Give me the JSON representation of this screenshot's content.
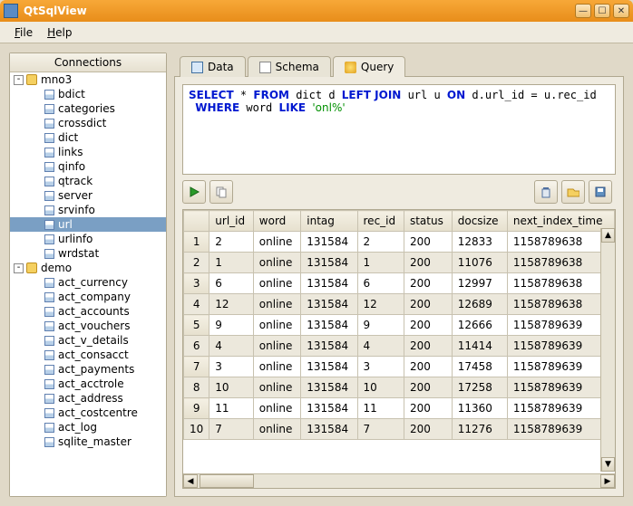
{
  "window": {
    "title": "QtSqlView"
  },
  "menu": {
    "file": "File",
    "help": "Help"
  },
  "sidebar": {
    "header": "Connections",
    "dbs": [
      {
        "name": "mno3",
        "tables": [
          "bdict",
          "categories",
          "crossdict",
          "dict",
          "links",
          "qinfo",
          "qtrack",
          "server",
          "srvinfo",
          "url",
          "urlinfo",
          "wrdstat"
        ],
        "selected": "url"
      },
      {
        "name": "demo",
        "tables": [
          "act_currency",
          "act_company",
          "act_accounts",
          "act_vouchers",
          "act_v_details",
          "act_consacct",
          "act_payments",
          "act_acctrole",
          "act_address",
          "act_costcentre",
          "act_log",
          "sqlite_master"
        ]
      }
    ]
  },
  "tabs": {
    "data": "Data",
    "schema": "Schema",
    "query": "Query",
    "active": "query"
  },
  "sql": {
    "tokens": [
      {
        "t": "SELECT",
        "k": true
      },
      {
        "t": " * "
      },
      {
        "t": "FROM",
        "k": true
      },
      {
        "t": " dict d "
      },
      {
        "t": "LEFT JOIN",
        "k": true
      },
      {
        "t": " url u "
      },
      {
        "t": "ON",
        "k": true
      },
      {
        "t": " d.url_id = u.rec_id\n "
      },
      {
        "t": "WHERE",
        "k": true
      },
      {
        "t": " word "
      },
      {
        "t": "LIKE",
        "k": true
      },
      {
        "t": " "
      },
      {
        "t": "'onl%'",
        "s": true
      }
    ]
  },
  "grid": {
    "columns": [
      "url_id",
      "word",
      "intag",
      "rec_id",
      "status",
      "docsize",
      "next_index_time"
    ],
    "rows": [
      [
        "2",
        "online",
        "131584",
        "2",
        "200",
        "12833",
        "1158789638"
      ],
      [
        "1",
        "online",
        "131584",
        "1",
        "200",
        "11076",
        "1158789638"
      ],
      [
        "6",
        "online",
        "131584",
        "6",
        "200",
        "12997",
        "1158789638"
      ],
      [
        "12",
        "online",
        "131584",
        "12",
        "200",
        "12689",
        "1158789638"
      ],
      [
        "9",
        "online",
        "131584",
        "9",
        "200",
        "12666",
        "1158789639"
      ],
      [
        "4",
        "online",
        "131584",
        "4",
        "200",
        "11414",
        "1158789639"
      ],
      [
        "3",
        "online",
        "131584",
        "3",
        "200",
        "17458",
        "1158789639"
      ],
      [
        "10",
        "online",
        "131584",
        "10",
        "200",
        "17258",
        "1158789639"
      ],
      [
        "11",
        "online",
        "131584",
        "11",
        "200",
        "11360",
        "1158789639"
      ],
      [
        "7",
        "online",
        "131584",
        "7",
        "200",
        "11276",
        "1158789639"
      ]
    ]
  }
}
